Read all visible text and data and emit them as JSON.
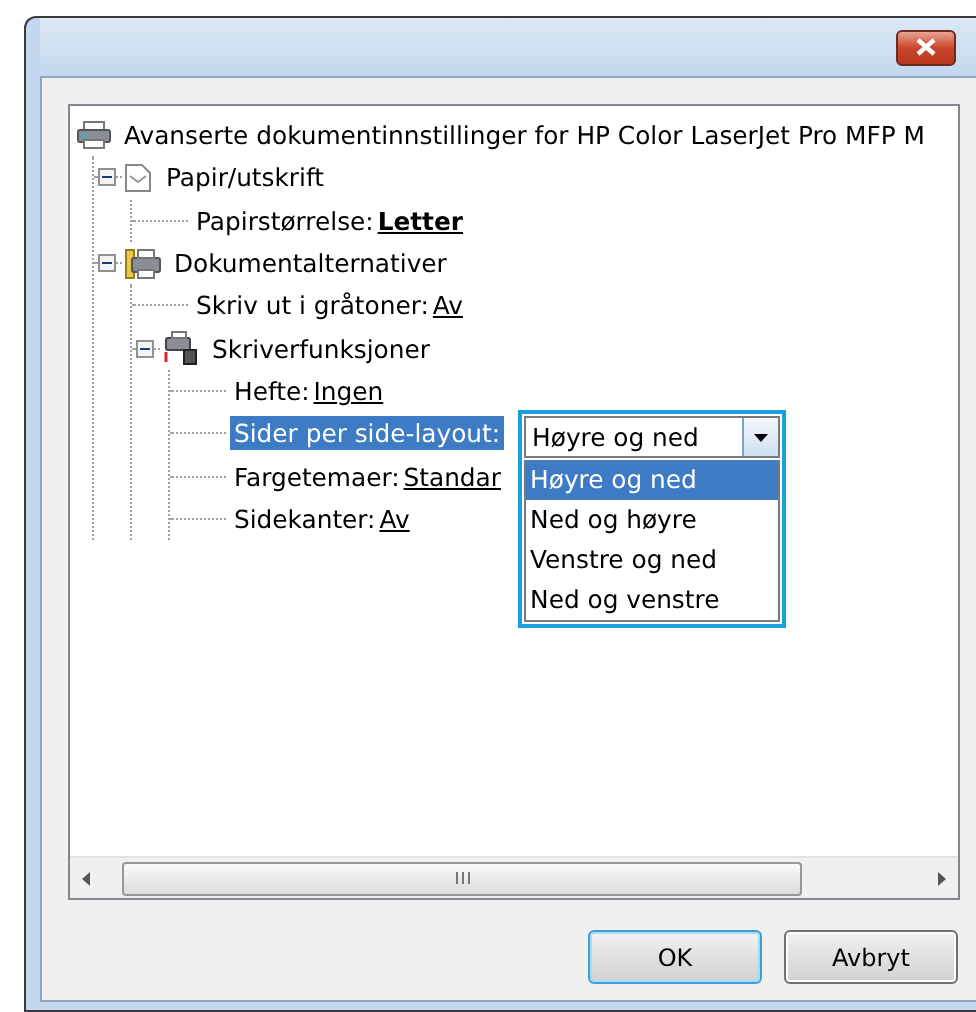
{
  "tree": {
    "kind": "printer",
    "label": "Avanserte dokumentinnstillinger for HP Color LaserJet Pro MFP M",
    "selected": false,
    "children": [
      {
        "kind": "paper",
        "label": "Papir/utskrift",
        "selected": false,
        "expanded": true,
        "children": [
          {
            "kind": "setting",
            "label": "Papirstørrelse:",
            "value": "Letter",
            "bold": true,
            "selected": false
          }
        ]
      },
      {
        "kind": "options",
        "label": "Dokumentalternativer",
        "selected": false,
        "expanded": true,
        "children": [
          {
            "kind": "setting",
            "label": "Skriv ut i gråtoner:",
            "value": "Av",
            "bold": false,
            "selected": false
          },
          {
            "kind": "functions",
            "label": "Skriverfunksjoner",
            "selected": false,
            "expanded": true,
            "children": [
              {
                "kind": "setting",
                "label": "Hefte:",
                "value": "Ingen",
                "bold": false,
                "selected": false
              },
              {
                "kind": "setting",
                "label": "Sider per side-layout:",
                "selected": true,
                "dropdown": {
                  "value": "Høyre og ned",
                  "options": [
                    {
                      "label": "Høyre og ned",
                      "selected": true
                    },
                    {
                      "label": "Ned og høyre",
                      "selected": false
                    },
                    {
                      "label": "Venstre og ned",
                      "selected": false
                    },
                    {
                      "label": "Ned og venstre",
                      "selected": false
                    }
                  ]
                }
              },
              {
                "kind": "setting",
                "label": "Fargetemaer:",
                "value": "Standar",
                "bold": false,
                "selected": false
              },
              {
                "kind": "setting",
                "label": "Sidekanter:",
                "value": "Av",
                "bold": false,
                "selected": false
              }
            ]
          }
        ]
      }
    ]
  },
  "buttons": [
    {
      "label": "OK",
      "default": true
    },
    {
      "label": "Avbryt",
      "default": false
    }
  ]
}
